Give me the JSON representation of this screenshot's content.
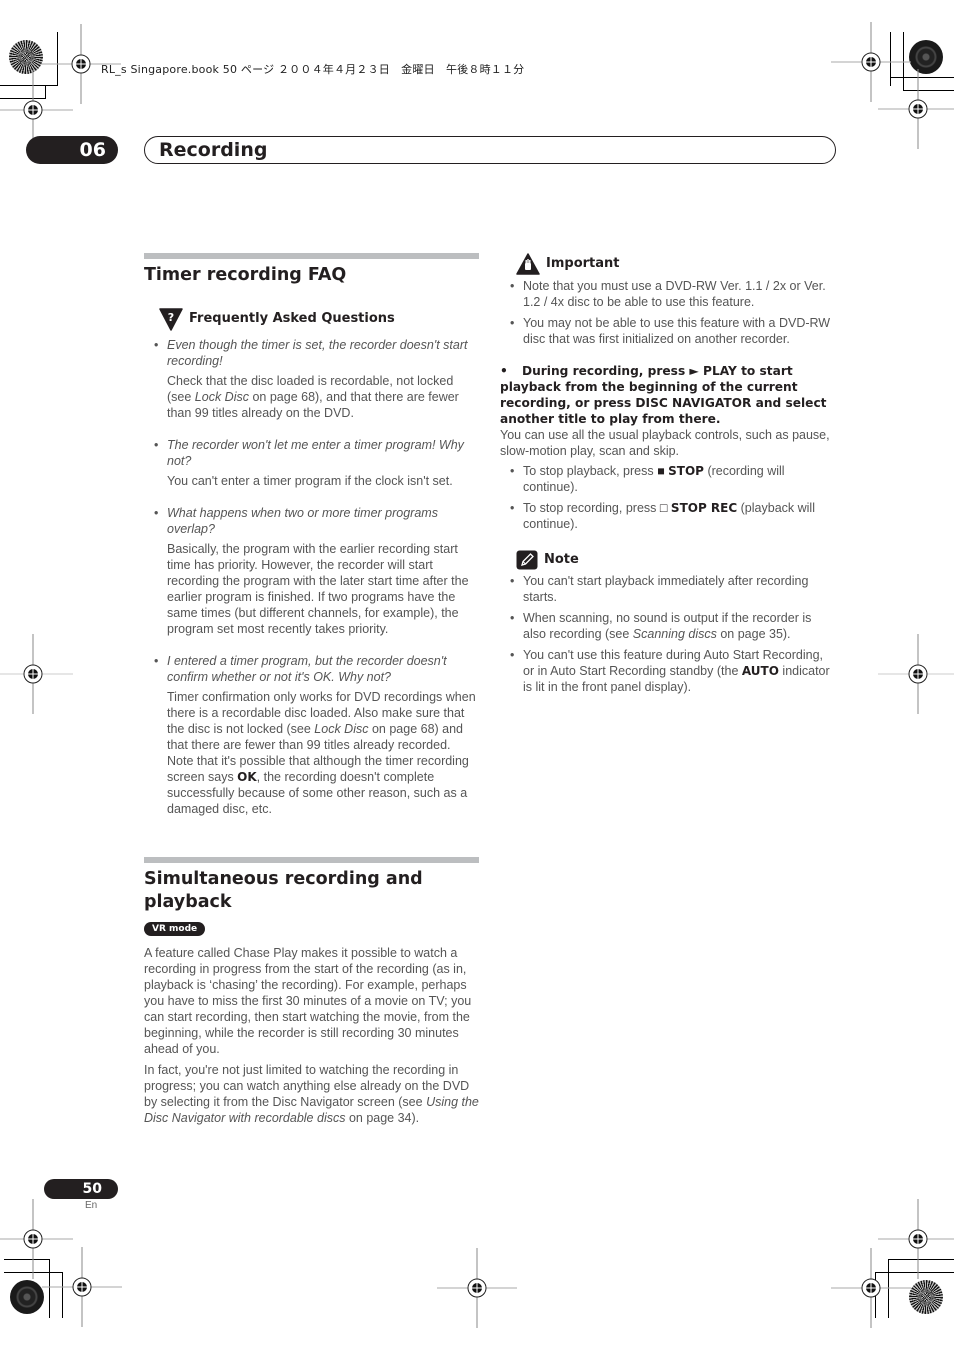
{
  "slug": "RL_s Singapore.book  50 ページ  ２００４年４月２３日　金曜日　午後８時１１分",
  "header": {
    "chapter_number": "06",
    "chapter_title": "Recording"
  },
  "timer_faq": {
    "title": "Timer recording FAQ",
    "callout_label": "Frequently Asked Questions",
    "items": [
      {
        "question": "Even though the timer is set, the recorder doesn't start recording!",
        "answer_parts": [
          "Check that the disc loaded is recordable, not locked (see ",
          "Lock Disc",
          " on page 68), and that there are fewer than 99 titles already on the DVD."
        ]
      },
      {
        "question": "The recorder won't let me enter a timer program! Why not?",
        "answer_parts": [
          "You can't enter a timer program if the clock isn't set."
        ]
      },
      {
        "question": "What happens when two or more timer programs overlap?",
        "answer_parts": [
          "Basically, the program with the earlier recording start time has priority. However, the recorder will start recording the program with the later start time after the earlier program is finished. If two programs have the same times (but different channels, for example), the program set most recently takes priority."
        ]
      },
      {
        "question": "I entered a timer program, but the recorder doesn't confirm whether or not it's OK. Why not?",
        "answer_parts": [
          "Timer confirmation only works for DVD recordings when there is a recordable disc loaded. Also make sure that the disc is not locked (see ",
          "Lock Disc",
          " on page 68) and that there are fewer than 99 titles already recorded. Note that it's possible that although the timer recording screen says ",
          "OK",
          ", the recording doesn't complete successfully because of some other reason, such as a damaged disc, etc."
        ]
      }
    ]
  },
  "simultaneous": {
    "title": "Simultaneous recording and playback",
    "badge": "VR mode",
    "para1": "A feature called Chase Play makes it possible to watch a recording in progress from the start of the recording (as in, playback is ‘chasing’ the recording). For example, perhaps you have to miss the first 30 minutes of a movie on TV; you can start recording, then start watching the movie, from the beginning, while the recorder is still recording 30 minutes ahead of you.",
    "para2_parts": [
      "In fact, you're not just limited to watching the recording in progress; you can watch anything else already on the DVD by selecting it from the Disc Navigator screen (see ",
      "Using the Disc Navigator with recordable discs",
      " on page 34)."
    ]
  },
  "important": {
    "label": "Important",
    "items": [
      "Note that you must use a DVD-RW Ver. 1.1 / 2x or Ver. 1.2 / 4x disc to be able to use this feature.",
      "You may not be able to use this feature with a DVD-RW disc that was first initialized on another recorder."
    ]
  },
  "step": {
    "bullet": "•",
    "text": "During recording, press ► PLAY to start playback from the beginning of the current recording, or press DISC NAVIGATOR and select another title to play from there.",
    "desc": "You can use all the usual playback controls, such as pause, slow-motion play, scan and skip.",
    "sub_items": [
      {
        "before": "To stop playback, press ",
        "icon": "■",
        "key": "STOP",
        "after": " (recording will continue)."
      },
      {
        "before": "To stop recording, press ",
        "icon": "□",
        "key": "STOP REC",
        "after": " (playback will continue)."
      }
    ]
  },
  "note": {
    "label": "Note",
    "items": [
      {
        "parts": [
          "You can't start playback immediately after recording starts."
        ]
      },
      {
        "parts": [
          "When scanning, no sound is output if the recorder is also recording (see ",
          "Scanning discs",
          " on page 35)."
        ]
      },
      {
        "parts": [
          "You can't use this feature during Auto Start Recording, or in Auto Start Recording standby (the ",
          "AUTO",
          " indicator is lit in the front panel display)."
        ]
      }
    ]
  },
  "footer": {
    "page_number": "50",
    "language": "En"
  }
}
